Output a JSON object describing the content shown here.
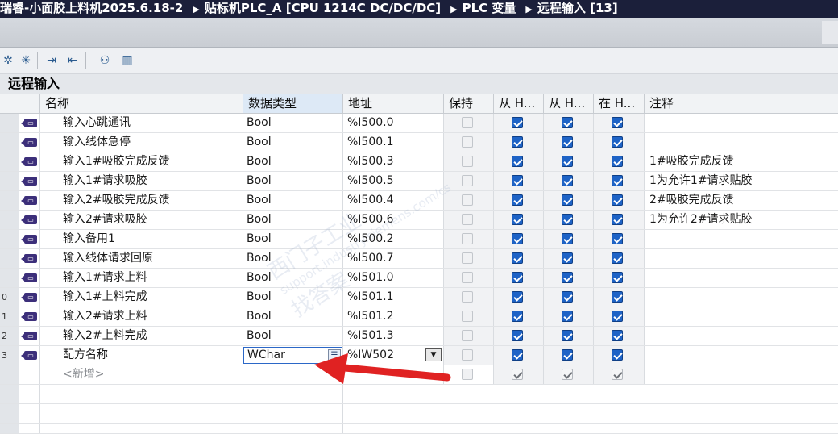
{
  "window": {
    "breadcrumb": [
      "瑞睿-小面胶上料机2025.6.18-2",
      "贴标机PLC_A [CPU 1214C DC/DC/DC]",
      "PLC 变量",
      "远程输入 [13]"
    ]
  },
  "section_title": "远程输入",
  "columns": {
    "name": "名称",
    "type": "数据类型",
    "addr": "地址",
    "retain": "保持",
    "f1": "从 H...",
    "f2": "从 H...",
    "f3": "在 H...",
    "comment": "注释"
  },
  "rows": [
    {
      "num": "",
      "name": "输入心跳通讯",
      "type": "Bool",
      "addr": "%I500.0",
      "comment": ""
    },
    {
      "num": "",
      "name": "输入线体急停",
      "type": "Bool",
      "addr": "%I500.1",
      "comment": ""
    },
    {
      "num": "",
      "name": "输入1#吸胶完成反馈",
      "type": "Bool",
      "addr": "%I500.3",
      "comment": "1#吸胶完成反馈"
    },
    {
      "num": "",
      "name": "输入1#请求吸胶",
      "type": "Bool",
      "addr": "%I500.5",
      "comment": "1为允许1#请求贴胶"
    },
    {
      "num": "",
      "name": "输入2#吸胶完成反馈",
      "type": "Bool",
      "addr": "%I500.4",
      "comment": "2#吸胶完成反馈"
    },
    {
      "num": "",
      "name": "输入2#请求吸胶",
      "type": "Bool",
      "addr": "%I500.6",
      "comment": "1为允许2#请求贴胶"
    },
    {
      "num": "",
      "name": "输入备用1",
      "type": "Bool",
      "addr": "%I500.2",
      "comment": ""
    },
    {
      "num": "",
      "name": "输入线体请求回原",
      "type": "Bool",
      "addr": "%I500.7",
      "comment": ""
    },
    {
      "num": "",
      "name": "输入1#请求上料",
      "type": "Bool",
      "addr": "%I501.0",
      "comment": ""
    },
    {
      "num": "0",
      "name": "输入1#上料完成",
      "type": "Bool",
      "addr": "%I501.1",
      "comment": ""
    },
    {
      "num": "1",
      "name": "输入2#请求上料",
      "type": "Bool",
      "addr": "%I501.2",
      "comment": ""
    },
    {
      "num": "2",
      "name": "输入2#上料完成",
      "type": "Bool",
      "addr": "%I501.3",
      "comment": ""
    }
  ],
  "edit_row": {
    "num": "3",
    "name": "配方名称",
    "type": "WChar",
    "addr": "%IW502"
  },
  "new_row": {
    "label": "<新增>"
  },
  "icons": {
    "tag": "plc-tag-icon",
    "toolbar": [
      "add-tag-icon",
      "add-group-icon",
      "export-icon",
      "import-icon",
      "monitor-icon",
      "chart-icon"
    ]
  },
  "colors": {
    "title_bg": "#1b1f3a",
    "check_blue": "#1e63c6",
    "arrow_red": "#e02222"
  },
  "watermark": {
    "line1": "西门子工业",
    "line2": "support.industry.siemens.com/cs",
    "line3": "找答案"
  }
}
